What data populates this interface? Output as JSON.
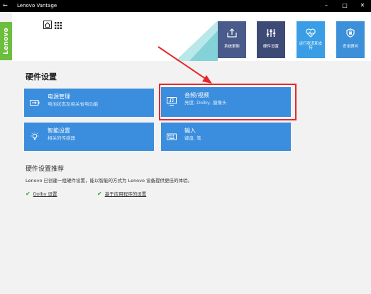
{
  "window": {
    "back_glyph": "←",
    "title": "Lenovo Vantage",
    "minimize_glyph": "–",
    "maximize_glyph": "□",
    "close_glyph": "✕"
  },
  "brand": {
    "logo_text": "Lenovo",
    "logo_color": "#6cbf3d"
  },
  "header": {
    "home_icon": "home-icon",
    "menu_icon": "grid-menu-icon",
    "nav_tiles": [
      {
        "label": "系统更新",
        "icon": "system-update-icon",
        "color": "#4a5a8a"
      },
      {
        "label": "硬件设置",
        "icon": "hardware-settings-icon",
        "color": "#3e4a76"
      },
      {
        "label": "运行状况和支持",
        "icon": "health-support-icon",
        "color": "#3a9ee6"
      },
      {
        "label": "安全顾问",
        "icon": "security-advisor-icon",
        "color": "#3c8fd9"
      }
    ]
  },
  "main": {
    "section_title": "硬件设置",
    "cards": [
      {
        "title": "电源管理",
        "subtitle": "电池状态及相关省电功能",
        "icon": "battery-icon"
      },
      {
        "title": "音频/视频",
        "subtitle": "亮度, Dolby, 摄像头",
        "icon": "display-audio-icon"
      },
      {
        "title": "智能设置",
        "subtitle": "相关的传感器",
        "icon": "light-bulb-icon"
      },
      {
        "title": "输入",
        "subtitle": "键盘, 笔",
        "icon": "keyboard-icon"
      }
    ],
    "recommend": {
      "title": "硬件设置推荐",
      "description": "Lenovo 已创建一组硬件设置，能以智能的方式为 Lenovo 设备提供更佳的体验。",
      "check_glyph": "✔",
      "links": [
        "Dolby 设置",
        "基于应用程序的设置"
      ]
    }
  },
  "annotation": {
    "color": "#e8262a"
  }
}
